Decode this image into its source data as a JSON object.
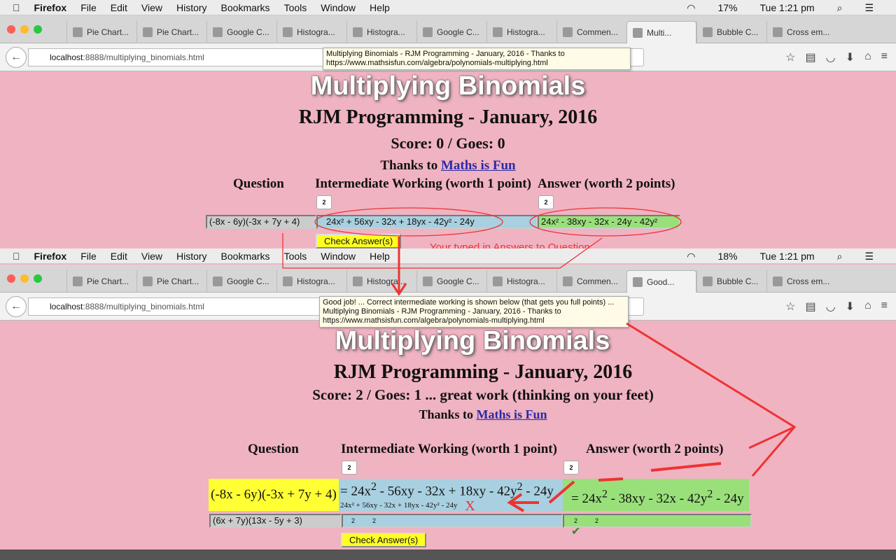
{
  "menubar": {
    "app": "Firefox",
    "items": [
      "File",
      "Edit",
      "View",
      "History",
      "Bookmarks",
      "Tools",
      "Window",
      "Help"
    ],
    "top_status": {
      "battery": "17%",
      "time": "Tue 1:21 pm"
    },
    "bottom_status": {
      "battery": "18%",
      "time": "Tue 1:21 pm"
    }
  },
  "tabs_top": [
    "Pie Chart...",
    "Pie Chart...",
    "Google C...",
    "Histogra...",
    "Histogra...",
    "Google C...",
    "Histogra...",
    "Commen...",
    "Multi...",
    "Bubble C...",
    "Cross em..."
  ],
  "tabs_bottom": [
    "Pie Chart...",
    "Pie Chart...",
    "Google C...",
    "Histogra...",
    "Histogra...",
    "Google C...",
    "Histogra...",
    "Commen...",
    "Good...",
    "Bubble C...",
    "Cross em..."
  ],
  "url": {
    "host": "localhost",
    "path": ":8888/multiplying_binomials.html"
  },
  "tooltip_top": [
    "Multiplying Binomials - RJM Programming - January, 2016 - Thanks to",
    "https://www.mathsisfun.com/algebra/polynomials-multiplying.html"
  ],
  "tooltip_bottom": [
    "Good job! ... Correct intermediate working is shown below (that gets you full points) ...",
    "Multiplying Binomials - RJM Programming - January, 2016 - Thanks to",
    "https://www.mathsisfun.com/algebra/polynomials-multiplying.html"
  ],
  "page": {
    "title": "Multiplying Binomials",
    "subtitle": "RJM Programming - January, 2016",
    "thanks": "Thanks to",
    "link": "Maths is Fun",
    "col_question": "Question",
    "col_working": "Intermediate Working (worth 1 point)",
    "col_answer": "Answer (worth 2 points)",
    "sup_label": "2",
    "check_button": "Check Answer(s)"
  },
  "top": {
    "score": "Score: 0 / Goes: 0",
    "question": "(-8x - 6y)(-3x + 7y + 4)",
    "working": "24x² + 56xy - 32x + 18yx - 42y² - 24y",
    "answer": "24x² - 38xy - 32x - 24y - 42y²",
    "annotation": "Your typed in Answers to Question"
  },
  "bottom": {
    "score": "Score: 2 / Goes: 1 ... great work (thinking on your feet)",
    "question": "(-8x - 6y)(-3x + 7y + 4)",
    "working_correct": "= 24x<sup>2</sup> - 56xy - 32x + 18xy - 42y<sup>2</sup> - 24y",
    "working_typed": "24x² + 56xy - 32x + 18yx - 42y² - 24y",
    "wrong_mark": "X",
    "answer_correct": "= 24x<sup>2</sup> - 38xy - 32x - 42y<sup>2</sup> - 24y",
    "right_mark": "✔",
    "next_question": "(6x + 7y)(13x - 5y + 3)",
    "next_working": "2          2",
    "next_answer": "2          2"
  },
  "colors": {
    "page_bg": "#f0b3c2",
    "question_bg": "#ffff33",
    "working_bg": "#a8d0e0",
    "answer_bg": "#99e07a",
    "annotation": "#e33333"
  }
}
